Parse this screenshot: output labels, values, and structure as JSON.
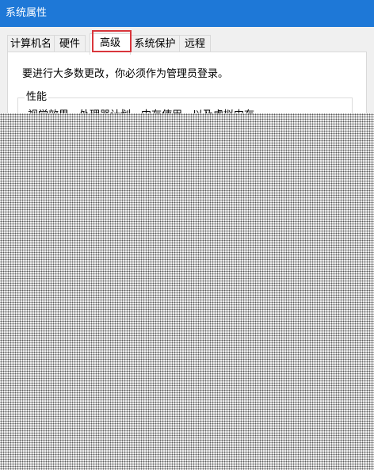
{
  "window": {
    "title": "系统属性",
    "title_bar_color": "#1e78d7"
  },
  "tabs": [
    {
      "label": "计算机名",
      "active": false
    },
    {
      "label": "硬件",
      "active": false
    },
    {
      "label": "高级",
      "active": true
    },
    {
      "label": "系统保护",
      "active": false
    },
    {
      "label": "远程",
      "active": false
    }
  ],
  "highlight_color": "#d9363c",
  "advanced": {
    "admin_notice": "要进行大多数更改，你必须作为管理员登录。",
    "performance": {
      "title": "性能",
      "description": "视觉效果，处理器计划，内存使用，以及虚拟内存"
    }
  }
}
